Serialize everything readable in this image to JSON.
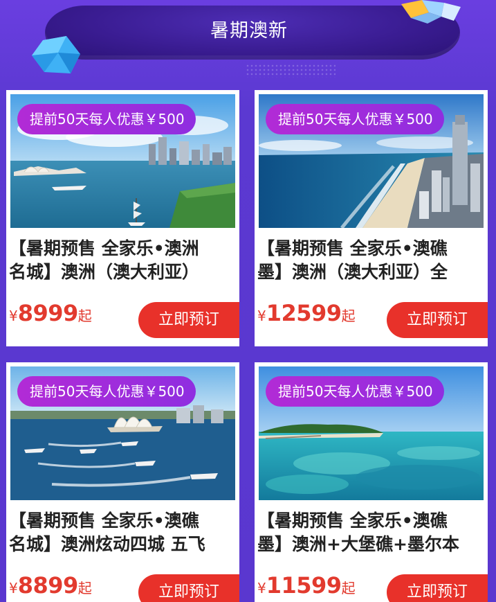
{
  "header": {
    "title": "暑期澳新"
  },
  "colors": {
    "background": "#5b39d1",
    "banner": "#3a1c92",
    "promo_badge": "#b22bd6",
    "price": "#e23a2e",
    "button": "#e8312a"
  },
  "cards": [
    {
      "promo": "提前50天每人优惠￥500",
      "title": "【暑期预售 全家乐•澳洲\n名城】澳洲（澳大利亚）",
      "price_prefix": "¥",
      "price": "8999",
      "price_suffix": "起",
      "button_label": "立即预订",
      "image": "sydney-harbour-skyline-photo"
    },
    {
      "promo": "提前50天每人优惠￥500",
      "title": "【暑期预售 全家乐•澳礁\n墨】澳洲（澳大利亚）全",
      "price_prefix": "¥",
      "price": "12599",
      "price_suffix": "起",
      "button_label": "立即预订",
      "image": "gold-coast-beach-photo"
    },
    {
      "promo": "提前50天每人优惠￥500",
      "title": "【暑期预售 全家乐•澳礁\n名城】澳洲炫动四城 五飞",
      "price_prefix": "¥",
      "price": "8899",
      "price_suffix": "起",
      "button_label": "立即预订",
      "image": "sydney-opera-house-boats-photo"
    },
    {
      "promo": "提前50天每人优惠￥500",
      "title": "【暑期预售 全家乐•澳礁\n墨】澳洲+大堡礁+墨尔本",
      "price_prefix": "¥",
      "price": "11599",
      "price_suffix": "起",
      "button_label": "立即预订",
      "image": "great-barrier-reef-island-photo"
    }
  ]
}
